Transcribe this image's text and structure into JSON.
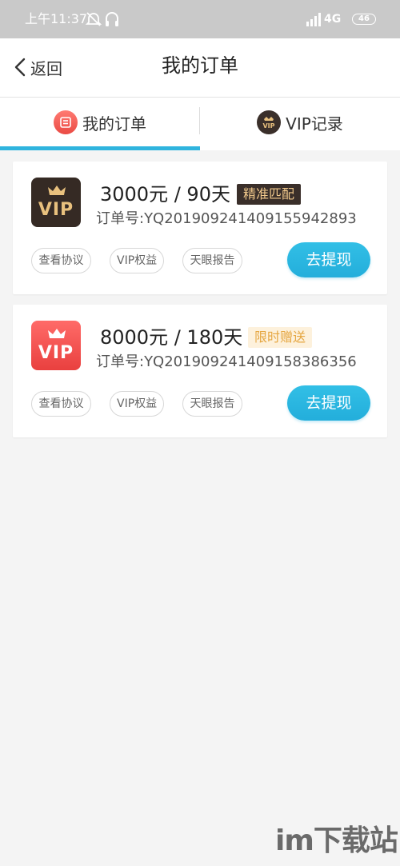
{
  "status_bar": {
    "time": "上午11:37",
    "network": "4G",
    "battery": "46"
  },
  "nav": {
    "back_label": "返回",
    "title": "我的订单"
  },
  "tabs": [
    {
      "label": "我的订单",
      "icon": "order-list-icon",
      "active": true
    },
    {
      "label": "VIP记录",
      "icon": "vip-badge-icon",
      "icon_text": "VIP",
      "active": false
    }
  ],
  "orders": [
    {
      "logo_text": "VIP",
      "price": "3000元 / 90天",
      "tag": "精准匹配",
      "order_no": "订单号:YQ2019092414091559428 93",
      "buttons": [
        "查看协议",
        "VIP权益",
        "天眼报告"
      ],
      "action": "去提现"
    },
    {
      "logo_text": "VIP",
      "price": "8000元 / 180天",
      "tag": "限时赠送",
      "order_no": "订单号:YQ20190924140915838635 6",
      "buttons": [
        "查看协议",
        "VIP权益",
        "天眼报告"
      ],
      "action": "去提现"
    }
  ],
  "watermark": "im下载站",
  "colors": {
    "accent": "#2fb4de",
    "vip_dark": "#352a24",
    "vip_gold": "#e9c17e",
    "vip_red": "#e9403f"
  }
}
